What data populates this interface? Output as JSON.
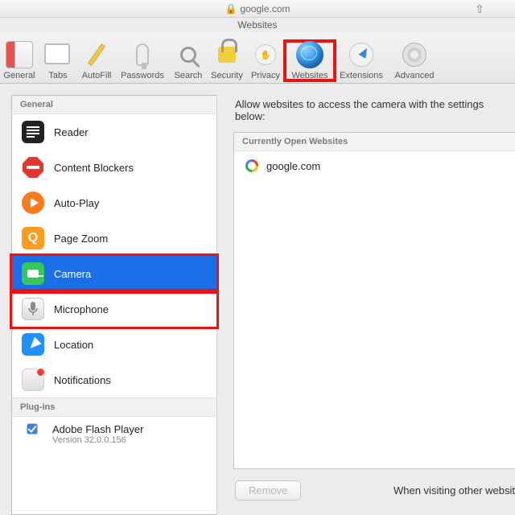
{
  "urlbar": {
    "domain": "google.com"
  },
  "window": {
    "title": "Websites"
  },
  "toolbar": {
    "items": [
      {
        "label": "General"
      },
      {
        "label": "Tabs"
      },
      {
        "label": "AutoFill"
      },
      {
        "label": "Passwords"
      },
      {
        "label": "Search"
      },
      {
        "label": "Security"
      },
      {
        "label": "Privacy"
      },
      {
        "label": "Websites"
      },
      {
        "label": "Extensions"
      },
      {
        "label": "Advanced"
      }
    ]
  },
  "sidebar": {
    "sections": [
      {
        "header": "General",
        "items": [
          {
            "label": "Reader"
          },
          {
            "label": "Content Blockers"
          },
          {
            "label": "Auto-Play"
          },
          {
            "label": "Page Zoom"
          },
          {
            "label": "Camera"
          },
          {
            "label": "Microphone"
          },
          {
            "label": "Location"
          },
          {
            "label": "Notifications"
          }
        ]
      },
      {
        "header": "Plug-ins",
        "items": [
          {
            "label": "Adobe Flash Player",
            "sub": "Version 32.0.0.156"
          }
        ]
      }
    ]
  },
  "panel": {
    "heading": "Allow websites to access the camera with the settings below:",
    "list_header": "Currently Open Websites",
    "sites": [
      {
        "domain": "google.com"
      }
    ],
    "remove_label": "Remove",
    "footer_text": "When visiting other websit"
  },
  "colors": {
    "selection": "#1a6fe8",
    "highlight": "#e11"
  },
  "zoom_icon_text": "Q"
}
